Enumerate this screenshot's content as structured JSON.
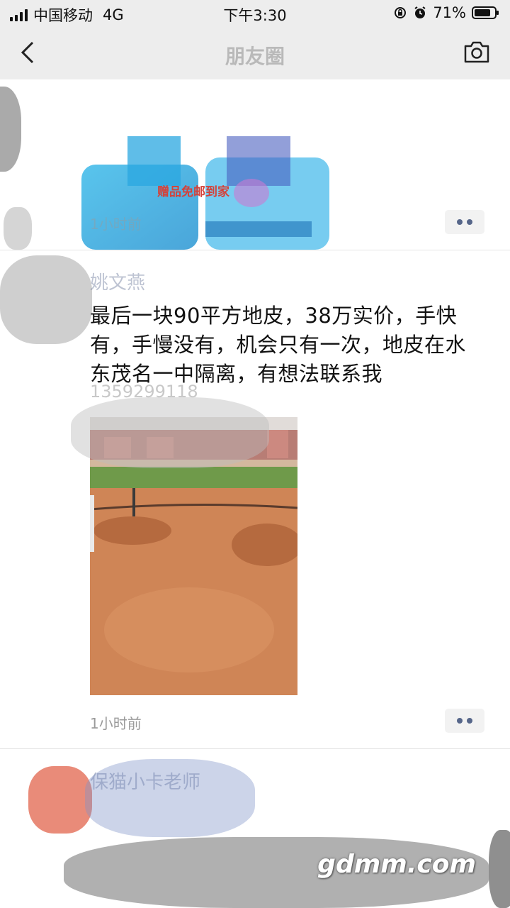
{
  "status_bar": {
    "carrier": "中国移动",
    "network": "4G",
    "time": "下午3:30",
    "battery": "71%"
  },
  "nav": {
    "title": "朋友圈",
    "back_icon": "chevron-left-icon",
    "camera_icon": "camera-icon"
  },
  "post1": {
    "gift_text": "赠品免邮到家",
    "time": "1小时前"
  },
  "post2": {
    "author": "姚文燕",
    "text": "最后一块90平方地皮，38万实价，手快有，手慢没有，机会只有一次，地皮在水东茂名一中隔离，有想法联系我",
    "phone": "1359299118",
    "time": "1小时前"
  },
  "post3": {
    "author": "保猫小卡老师"
  },
  "watermark": "gdmm.com",
  "colors": {
    "name_link": "#5b6a91",
    "time_gray": "#9a9a9a",
    "header_bg": "#ededed"
  }
}
